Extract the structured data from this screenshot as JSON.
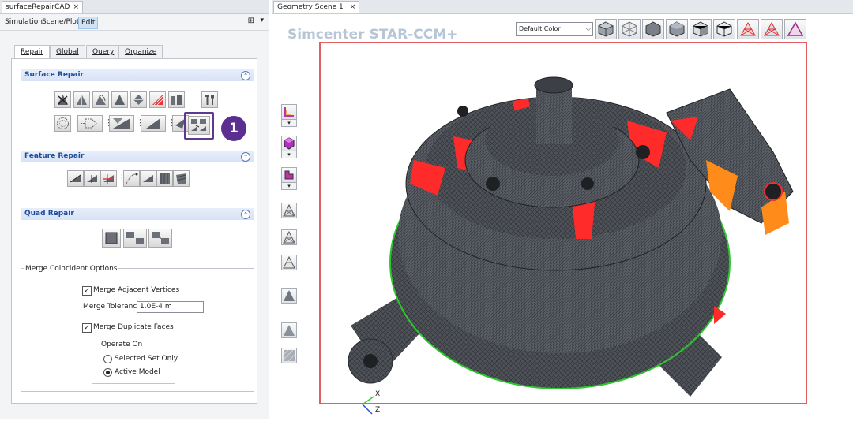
{
  "left_panel": {
    "tab_title": "surfaceRepairCAD",
    "tab_close": "×",
    "minimize": "–",
    "menu": [
      "Simulation",
      "Scene/Plot",
      "Edit"
    ],
    "tabs": [
      "Repair",
      "Global",
      "Query",
      "Organize"
    ],
    "sections": {
      "surface_repair": "Surface Repair",
      "feature_repair": "Feature Repair",
      "quad_repair": "Quad Repair"
    },
    "badge": "1",
    "merge": {
      "title": "Merge Coincident Options",
      "adjacent_label": "Merge Adjacent Vertices",
      "adjacent_checked": true,
      "tolerance_label": "Merge Tolerance",
      "tolerance_value": "1.0E-4 m",
      "duplicate_label": "Merge Duplicate Faces",
      "duplicate_checked": true,
      "operate_title": "Operate On",
      "options": [
        "Selected Set Only",
        "Active Model"
      ],
      "selected_option": "Active Model"
    }
  },
  "scene": {
    "tab_title": "Geometry Scene 1",
    "tab_close": "×",
    "brand": "Simcenter STAR-CCM+",
    "color_mode": "Default Color",
    "axis_labels": [
      "X",
      "Z"
    ]
  },
  "colors": {
    "badge": "#5b2e8f",
    "frame": "#e05f62",
    "highlight_red": "#ff2a2a",
    "highlight_orange": "#ff8c1a",
    "edge_green": "#2dc82d",
    "mesh": "#4e5258"
  }
}
